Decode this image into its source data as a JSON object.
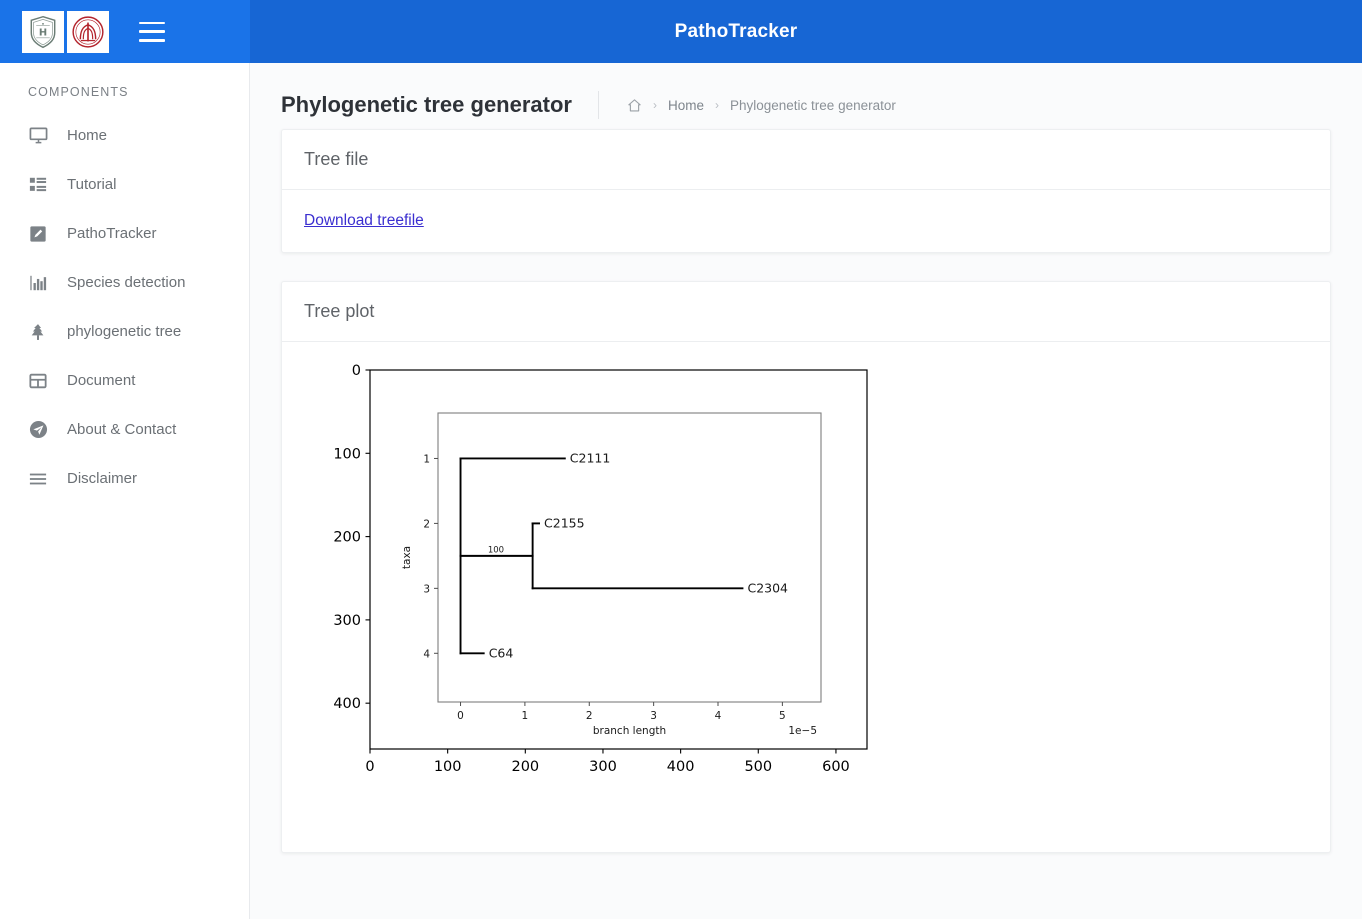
{
  "navbar": {
    "title": "PathoTracker",
    "menu_icon": "hamburger-icon",
    "logo_left": "hit-shield-logo",
    "logo_right": "pku-circular-logo",
    "brand_bg": "#1a73e8",
    "bar_bg": "#1766d4"
  },
  "sidebar": {
    "heading": "COMPONENTS",
    "items": [
      {
        "label": "Home",
        "icon": "monitor-icon"
      },
      {
        "label": "Tutorial",
        "icon": "list-grid-icon"
      },
      {
        "label": "PathoTracker",
        "icon": "pencil-square-icon"
      },
      {
        "label": "Species detection",
        "icon": "bar-chart-icon"
      },
      {
        "label": "phylogenetic tree",
        "icon": "tree-icon"
      },
      {
        "label": "Document",
        "icon": "table-icon"
      },
      {
        "label": "About & Contact",
        "icon": "paper-plane-icon"
      },
      {
        "label": "Disclaimer",
        "icon": "menu-lines-icon"
      }
    ]
  },
  "page": {
    "title": "Phylogenetic tree generator",
    "breadcrumb": {
      "home_icon": "home-icon",
      "home": "Home",
      "current": "Phylogenetic tree generator",
      "separator": "›"
    }
  },
  "cards": {
    "tree_file": {
      "header": "Tree file",
      "download_label": "Download treefile",
      "link_color": "#3b2fd0"
    },
    "tree_plot": {
      "header": "Tree plot"
    }
  },
  "chart_data": {
    "type": "tree",
    "title": "",
    "outer": {
      "type": "image-axes",
      "xlabel": "",
      "ylabel": "",
      "xticks": [
        0,
        100,
        200,
        300,
        400,
        500,
        600
      ],
      "yticks": [
        0,
        100,
        200,
        300,
        400
      ],
      "xlim": [
        0,
        640
      ],
      "ylim": [
        455,
        0
      ],
      "grid": false
    },
    "inner": {
      "type": "phylogram",
      "xlabel": "branch length",
      "ylabel": "taxa",
      "x_offset_text": "1e−5",
      "xticks": [
        0,
        1,
        2,
        3,
        4,
        5
      ],
      "xtick_labels": [
        "0",
        "1",
        "2",
        "3",
        "4",
        "5"
      ],
      "yticks": [
        1,
        2,
        3,
        4
      ],
      "ytick_labels": [
        "1",
        "2",
        "3",
        "4"
      ],
      "xlim": [
        -0.35,
        5.6
      ],
      "ylim": [
        4.75,
        0.3
      ],
      "grid": false,
      "support_labels": [
        {
          "text": "100",
          "x": 0.55,
          "y": 2.5
        }
      ],
      "tips": [
        {
          "name": "C2111",
          "taxon_index": 1,
          "branch_x": 1.62
        },
        {
          "name": "C2155",
          "taxon_index": 2,
          "branch_x": 1.22
        },
        {
          "name": "C2304",
          "taxon_index": 3,
          "branch_x": 4.38
        },
        {
          "name": "C64",
          "taxon_index": 4,
          "branch_x": 0.36
        }
      ],
      "nodes": [
        {
          "id": "root",
          "x": 0.0,
          "y_from": 1.0,
          "y_to": 4.0
        },
        {
          "id": "internal",
          "x": 1.12,
          "y_from": 2.0,
          "y_to": 3.0
        }
      ],
      "branches": [
        {
          "from_x": 0.0,
          "to_x": 1.62,
          "y": 1.0,
          "tip": "C2111"
        },
        {
          "from_x": 0.0,
          "to_x": 1.12,
          "y": 2.5,
          "tip": ""
        },
        {
          "from_x": 1.12,
          "to_x": 1.22,
          "y": 2.0,
          "tip": "C2155"
        },
        {
          "from_x": 1.12,
          "to_x": 4.38,
          "y": 3.0,
          "tip": "C2304"
        },
        {
          "from_x": 0.0,
          "to_x": 0.36,
          "y": 4.0,
          "tip": "C64"
        }
      ]
    }
  }
}
